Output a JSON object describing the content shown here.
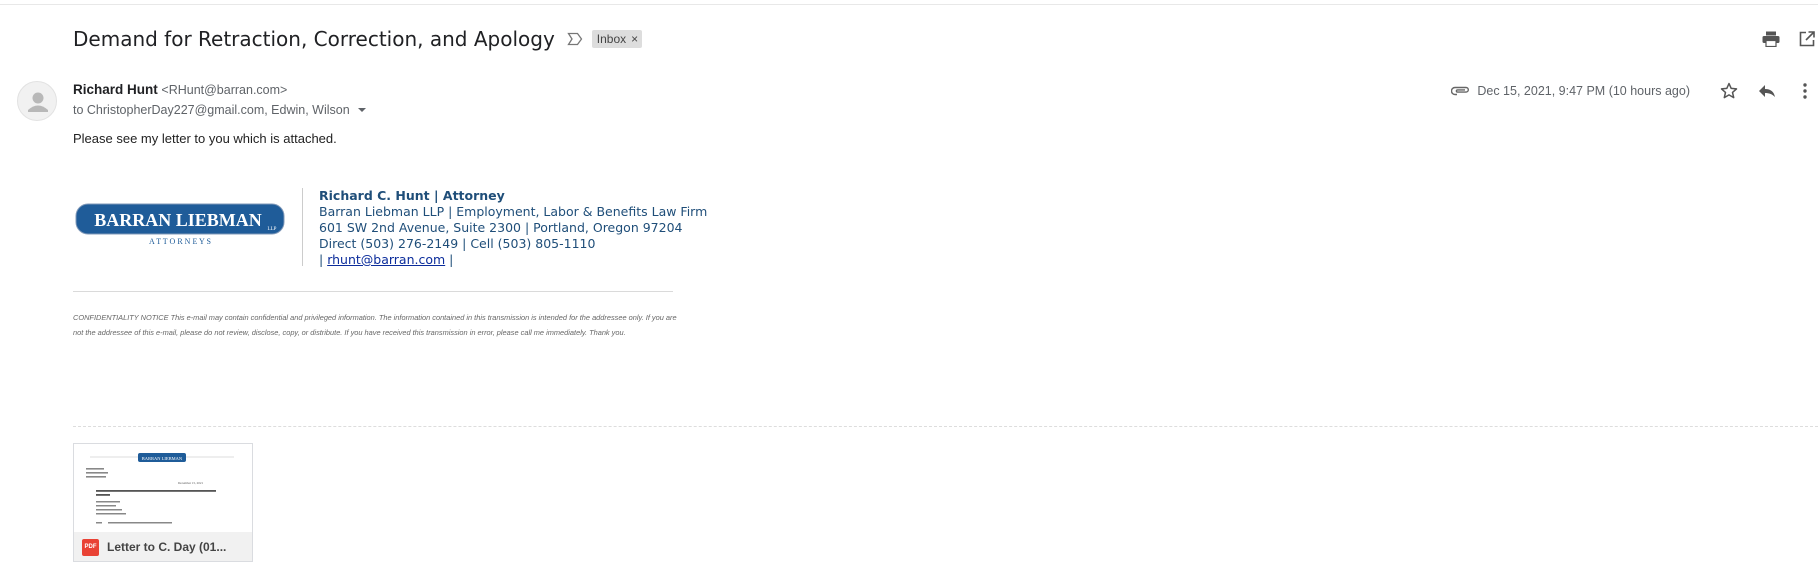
{
  "email": {
    "subject": "Demand for Retraction, Correction, and Apology",
    "label": "Inbox",
    "sender_name": "Richard Hunt",
    "sender_email": "<RHunt@barran.com>",
    "to_line": "to ChristopherDay227@gmail.com, Edwin, Wilson",
    "date": "Dec 15, 2021, 9:47 PM (10 hours ago)",
    "body": "Please see my letter to you which is attached."
  },
  "signature": {
    "logo_text": "BARRAN LIEBMAN",
    "logo_suffix": "LLP",
    "logo_subtext": "A T T O R N E Y S",
    "name_title": "Richard C. Hunt | Attorney",
    "firm_line": "Barran Liebman LLP | Employment, Labor & Benefits Law Firm",
    "address": "601 SW 2nd Avenue, Suite 2300 | Portland, Oregon 97204",
    "phones": "Direct (503) 276-2149 | Cell (503) 805-1110",
    "email_prefix": "| ",
    "email_link": "rhunt@barran.com",
    "email_suffix": " |"
  },
  "confidentiality": "CONFIDENTIALITY NOTICE This e-mail may contain confidential and privileged information. The information contained in this transmission is intended for the addressee only. If you are not the addressee of this e-mail, please do not review, disclose, copy, or distribute. If you have received this transmission in error, please call me immediately. Thank you.",
  "attachment": {
    "type_badge": "PDF",
    "name": "Letter to C. Day (01...",
    "thumb_logo": "BARRAN LIEBMAN",
    "thumb_date": "December 15, 2021"
  },
  "icons": {
    "print": "print-icon",
    "open_new_window": "open-in-new-window-icon",
    "attachment": "paperclip-icon",
    "star": "star-icon",
    "reply": "reply-icon",
    "more": "more-vertical-icon",
    "importance": "importance-marker-icon",
    "avatar": "default-avatar-icon"
  },
  "colors": {
    "brand_blue": "#1f5c99",
    "signature_text": "#1f4e79",
    "link": "#0b2c9b",
    "pdf_red": "#e94235",
    "label_chip_bg": "#dddddd"
  }
}
